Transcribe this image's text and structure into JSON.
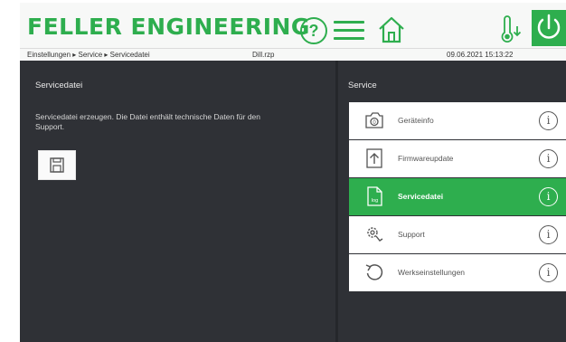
{
  "header": {
    "logo": "FELLER ENGINEERING",
    "help_icon_text": "?",
    "icons": [
      "help-icon",
      "menu-icon",
      "home-icon",
      "thermometer-icon",
      "power-icon"
    ]
  },
  "breadcrumb": "Einstellungen ▸ Service ▸ Servicedatei",
  "filename": "Dill.rzp",
  "datetime": "09.06.2021 15:13:22",
  "left": {
    "title": "Servicedatei",
    "description": "Servicedatei erzeugen. Die Datei enthält technische Daten für den Support."
  },
  "right": {
    "title": "Service",
    "items": [
      {
        "label": "Geräteinfo",
        "icon": "camera-icon",
        "active": false
      },
      {
        "label": "Firmwareupdate",
        "icon": "upload-icon",
        "active": false
      },
      {
        "label": "Servicedatei",
        "icon": "log-file-icon",
        "active": true
      },
      {
        "label": "Support",
        "icon": "support-gear-icon",
        "active": false
      },
      {
        "label": "Werkseinstellungen",
        "icon": "reset-icon",
        "active": false
      }
    ],
    "info_glyph": "i"
  },
  "colors": {
    "accent": "#2eae4e",
    "background": "#2f3136",
    "header": "#f7f8f7"
  }
}
